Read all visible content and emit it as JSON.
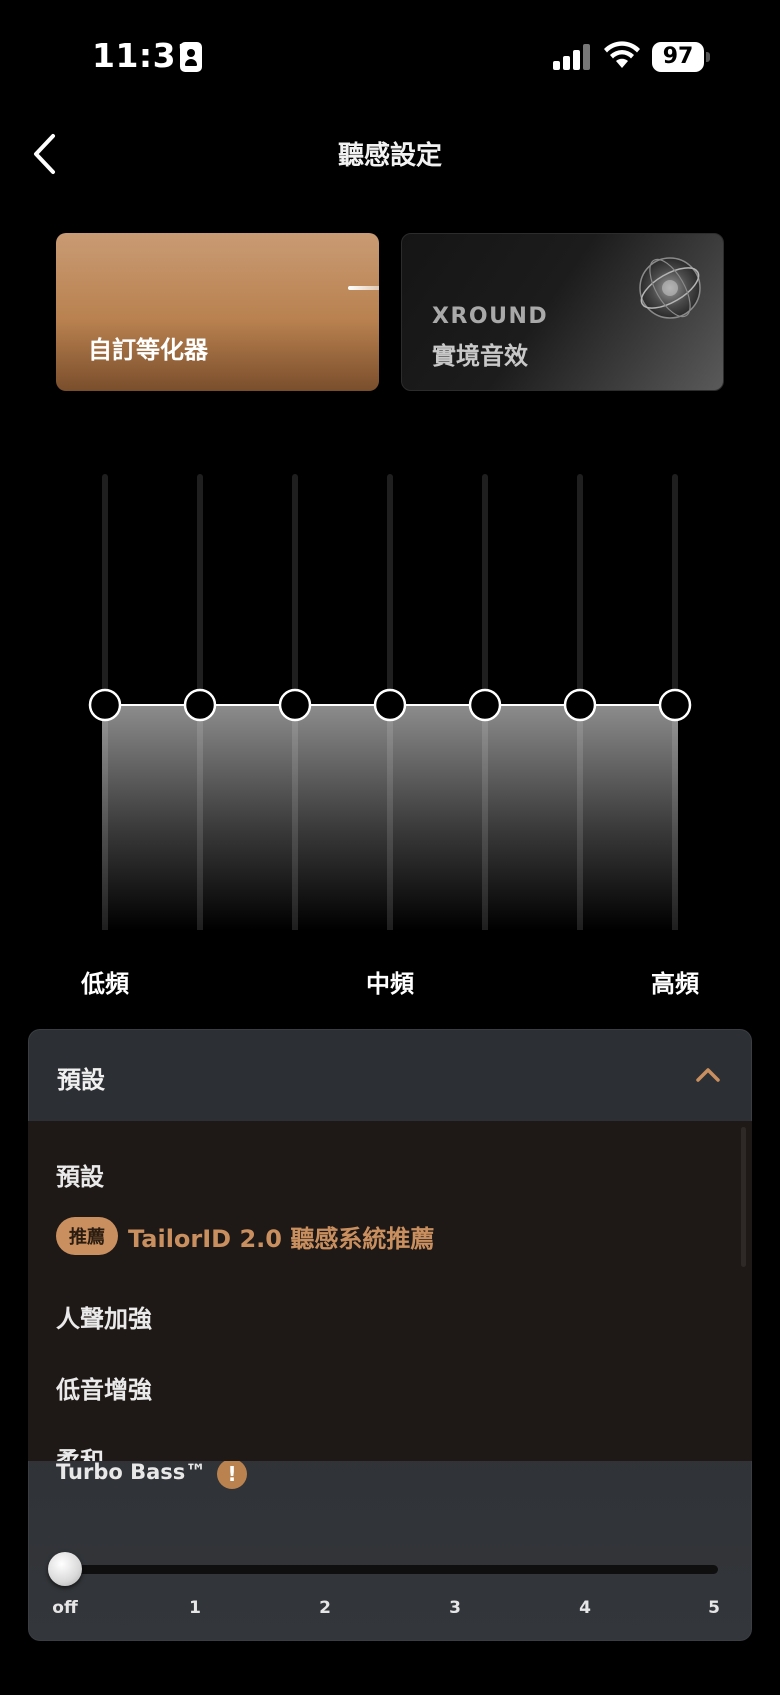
{
  "status_bar": {
    "time": "11:31",
    "battery": "97"
  },
  "header": {
    "title": "聽感設定"
  },
  "modes": [
    {
      "label": "自訂等化器"
    },
    {
      "brand": "XROUND",
      "label": "實境音效"
    }
  ],
  "eq": {
    "bands": 7,
    "band_levels": [
      0,
      0,
      0,
      0,
      0,
      0,
      0
    ],
    "labels": {
      "low": "低頻",
      "mid": "中頻",
      "high": "高頻"
    }
  },
  "preset": {
    "selected": "預設",
    "options": [
      {
        "label": "預設"
      },
      {
        "badge": "推薦",
        "label": "TailorID 2.0 聽感系統推薦"
      },
      {
        "label": "人聲加強"
      },
      {
        "label": "低音增強"
      },
      {
        "label": "柔和"
      }
    ]
  },
  "turbo_bass": {
    "title": "Turbo Bass™",
    "warning": "!",
    "value": "off",
    "ticks": [
      "off",
      "1",
      "2",
      "3",
      "4",
      "5"
    ]
  },
  "colors": {
    "accent": "#c98f5f",
    "panel": "#2c2f33",
    "dropdown": "#1e1916"
  }
}
